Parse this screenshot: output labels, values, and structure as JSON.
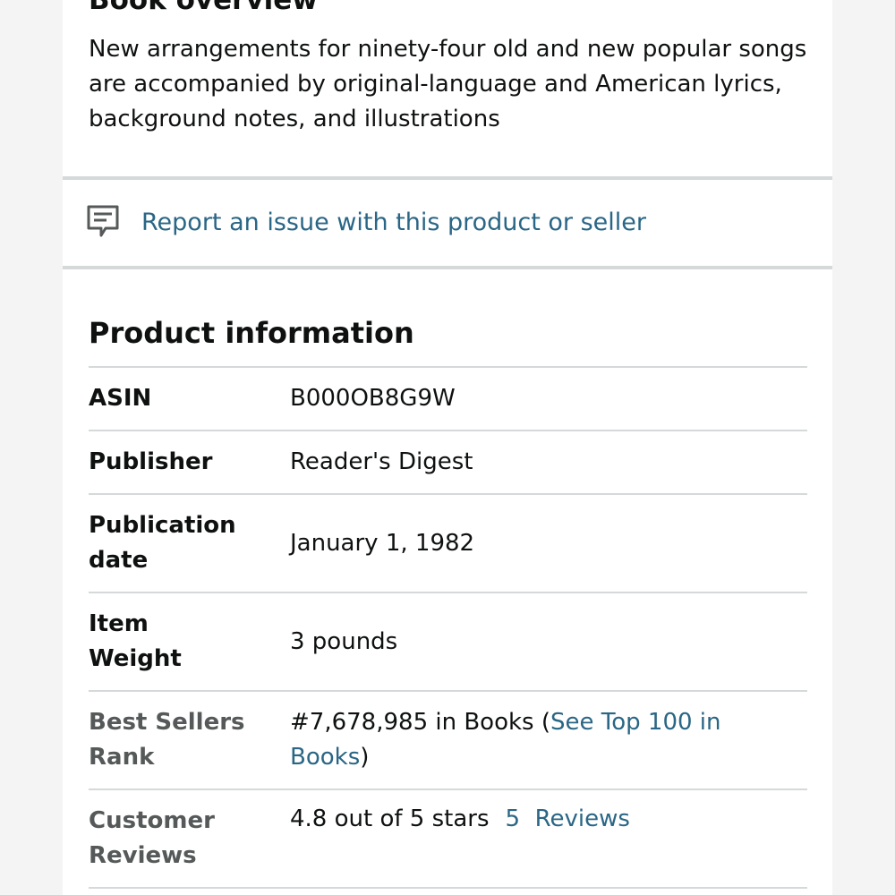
{
  "overview": {
    "title": "Book overview",
    "text": "New arrangements for ninety-four old and new popular songs are accompanied by original-language and American lyrics, background notes, and illustrations"
  },
  "report": {
    "icon": "report-issue-icon",
    "label": "Report an issue with this product or seller"
  },
  "product_info": {
    "title": "Product information",
    "rows": [
      {
        "label_1": "ASIN",
        "value": "B000OB8G9W"
      },
      {
        "label_1": "Publisher",
        "value": "Reader's Digest"
      },
      {
        "label_1": "Publication",
        "label_2": "date",
        "value": "January 1, 1982"
      },
      {
        "label_1": "Item",
        "label_2": "Weight",
        "value": "3 pounds"
      },
      {
        "label_1": "Best Sellers",
        "label_2": "Rank",
        "value_prefix": "#7,678,985 in Books (",
        "link_1": "See Top 100 in",
        "link_2": "Books",
        "value_suffix": ")"
      },
      {
        "label_1": "Customer",
        "label_2": "Reviews",
        "rating_text": "4.8 out of 5 stars",
        "reviews_link": "5  Reviews"
      }
    ]
  },
  "colors": {
    "link": "#2a6685",
    "divider": "#d5d9d9",
    "muted_label": "#565959",
    "page_background": "#f4f4f4",
    "card_background": "#ffffff"
  }
}
